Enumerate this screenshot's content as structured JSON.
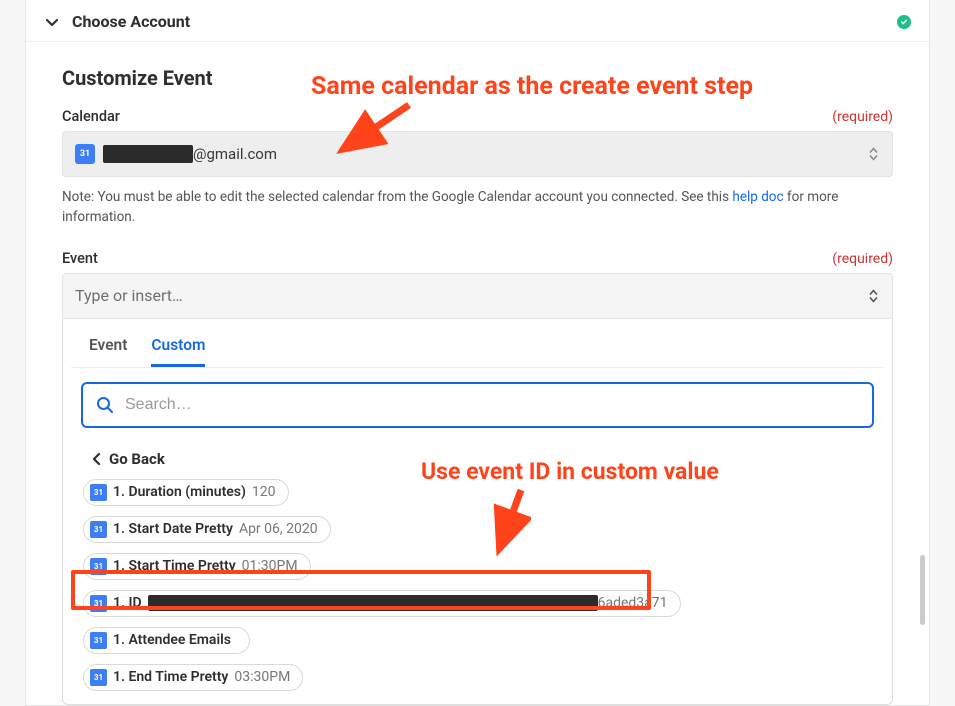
{
  "header": {
    "title": "Choose Account"
  },
  "section": {
    "title": "Customize Event",
    "calendar": {
      "label": "Calendar",
      "required": "(required)",
      "value_suffix": "@gmail.com",
      "note_prefix": "Note: You must be able to edit the selected calendar from the Google Calendar account you connected. See this ",
      "note_link": "help doc",
      "note_suffix": " for more information.",
      "icon_text": "31"
    },
    "event": {
      "label": "Event",
      "required": "(required)",
      "placeholder": "Type or insert…"
    }
  },
  "dropdown": {
    "tabs": {
      "event": "Event",
      "custom": "Custom"
    },
    "search_placeholder": "Search…",
    "go_back": "Go Back",
    "chips": [
      {
        "name": "1. Duration (minutes)",
        "val": "120"
      },
      {
        "name": "1. Start Date Pretty",
        "val": "Apr 06, 2020"
      },
      {
        "name": "1. Start Time Pretty",
        "val": "01:30PM"
      },
      {
        "name": "1. ID",
        "val_suffix": "6aded3a71",
        "redacted": true,
        "redact_w": 450
      },
      {
        "name": "1. Attendee Emails",
        "val": ""
      },
      {
        "name": "1. End Time Pretty",
        "val": "03:30PM"
      }
    ],
    "chip_icon_text": "31"
  },
  "annotations": {
    "anno1": "Same calendar as the create event step",
    "anno2": "Use event ID in custom value"
  }
}
